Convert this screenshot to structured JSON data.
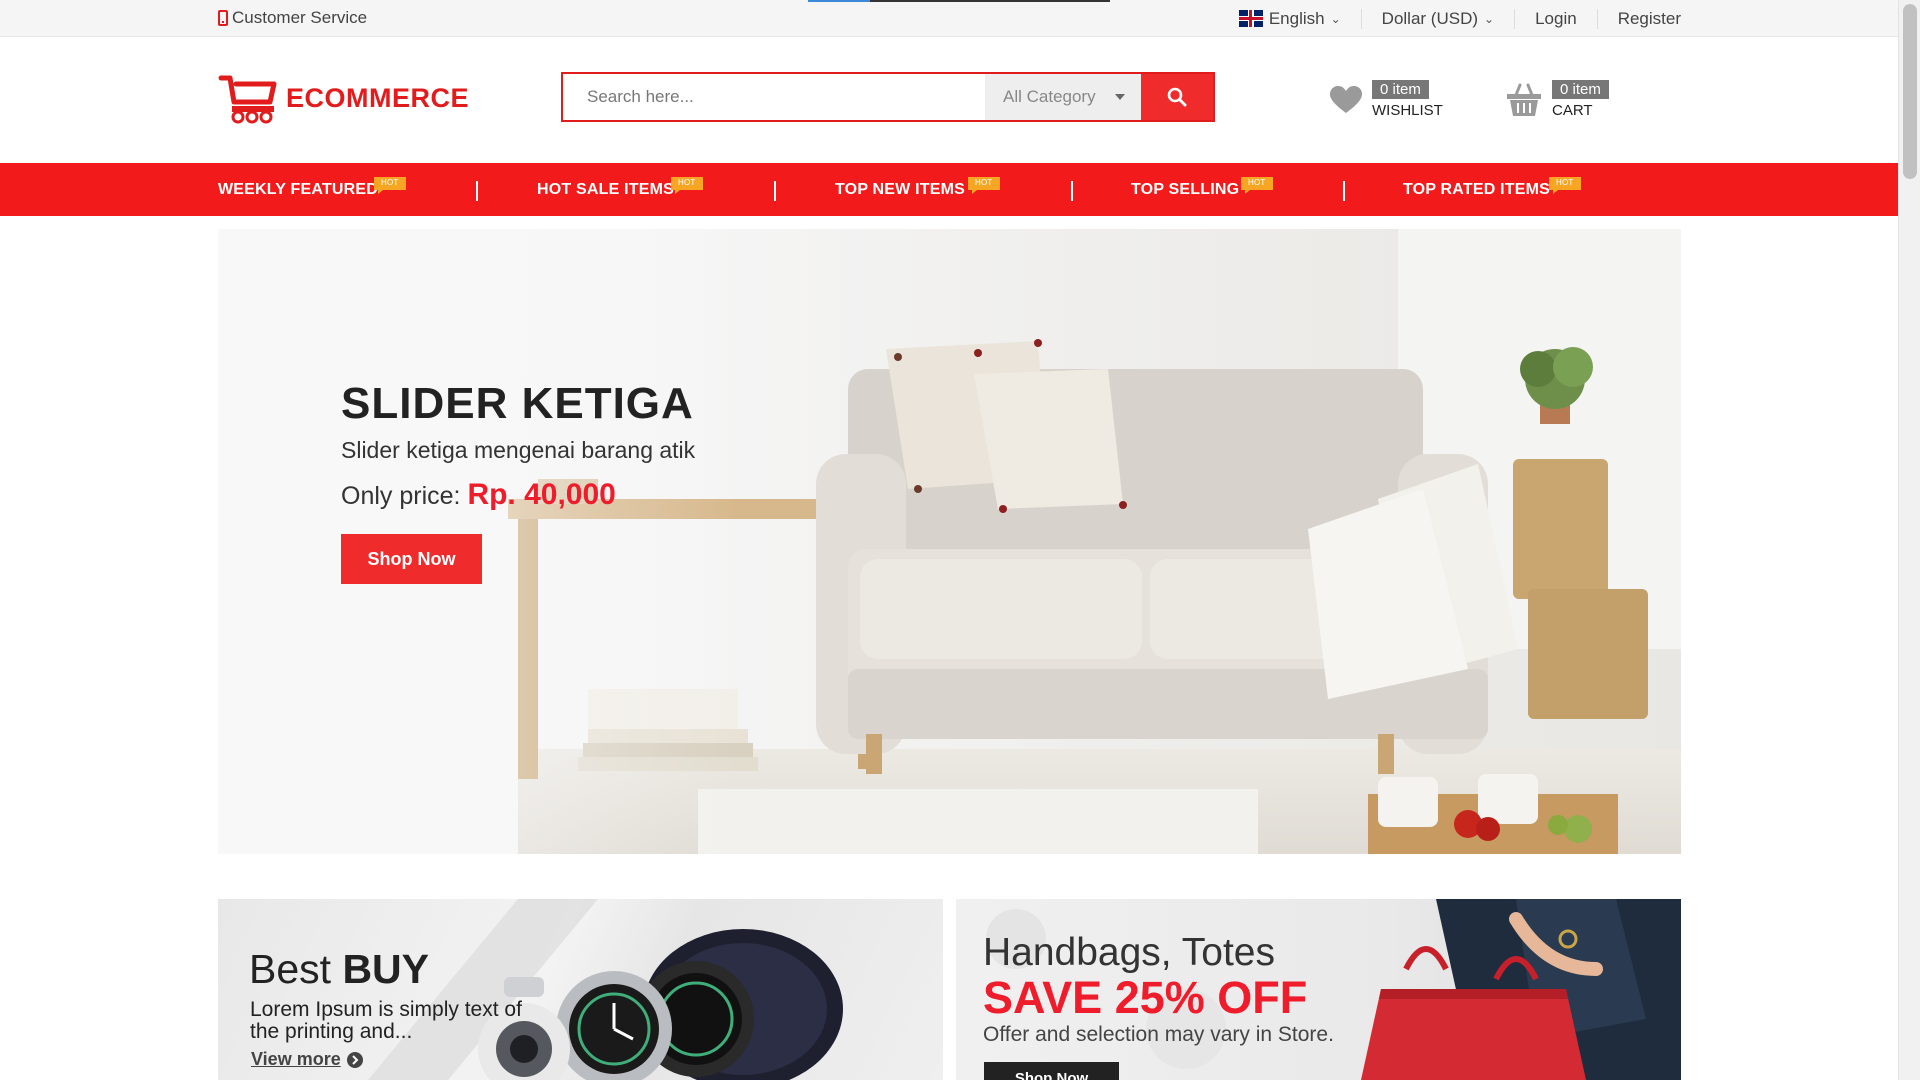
{
  "topbar": {
    "customer_service": "Customer Service",
    "language": "English",
    "currency": "Dollar (USD)",
    "login": "Login",
    "register": "Register"
  },
  "header": {
    "logo_text": "ECOMMERCE",
    "search_placeholder": "Search here...",
    "category": "All Category",
    "wishlist": {
      "count": "0 item",
      "label": "WISHLIST"
    },
    "cart": {
      "count": "0 item",
      "label": "CART"
    }
  },
  "nav": {
    "badge": "HOT",
    "items": [
      {
        "label": "WEEKLY FEATURED"
      },
      {
        "label": "HOT SALE ITEMS"
      },
      {
        "label": "TOP NEW ITEMS"
      },
      {
        "label": "TOP SELLING"
      },
      {
        "label": "TOP RATED ITEMS"
      }
    ]
  },
  "hero": {
    "title": "SLIDER KETIGA",
    "subtitle": "Slider ketiga mengenai barang atik",
    "price_label": "Only price:",
    "price_value": "Rp. 40,000",
    "button": "Shop Now"
  },
  "promo1": {
    "title_light": "Best",
    "title_bold": "BUY",
    "text": "Lorem Ipsum is simply text of the printing and...",
    "link": "View more"
  },
  "promo2": {
    "title": "Handbags, Totes",
    "save": "SAVE 25% OFF",
    "text": "Offer and selection may vary in Store.",
    "button": "Shop Now"
  },
  "colors": {
    "brand_red": "#ef2b2b",
    "hot_badge": "#f6a623"
  }
}
